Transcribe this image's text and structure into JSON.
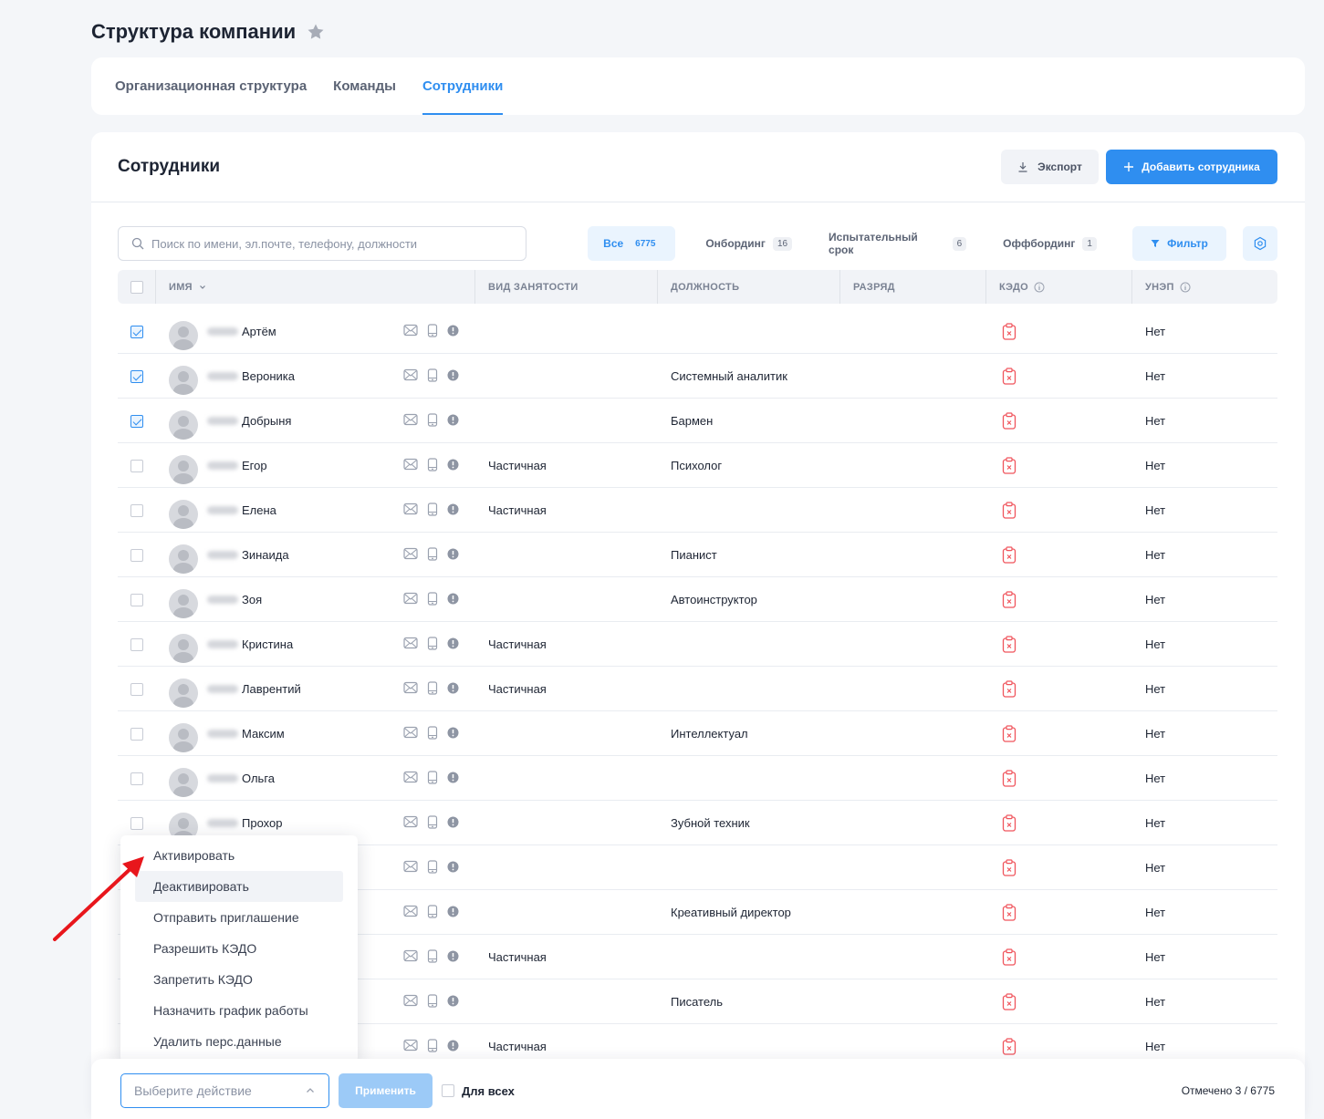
{
  "page": {
    "title": "Структура компании"
  },
  "tabs": [
    {
      "label": "Организационная структура"
    },
    {
      "label": "Команды"
    },
    {
      "label": "Сотрудники"
    }
  ],
  "card": {
    "title": "Сотрудники",
    "export_label": "Экспорт",
    "add_label": "Добавить сотрудника"
  },
  "search": {
    "placeholder": "Поиск по имени, эл.почте, телефону, должности"
  },
  "segments": [
    {
      "label": "Все",
      "count": "6775"
    },
    {
      "label": "Онбординг",
      "count": "16"
    },
    {
      "label": "Испытательный срок",
      "count": "6"
    },
    {
      "label": "Оффбординг",
      "count": "1"
    }
  ],
  "filter_label": "Фильтр",
  "columns": {
    "name": "ИМЯ",
    "employment": "ВИД ЗАНЯТОСТИ",
    "position": "ДОЛЖНОСТЬ",
    "grade": "РАЗРЯД",
    "kedo": "КЭДО",
    "unep": "УНЭП"
  },
  "rows": [
    {
      "name": "Артём",
      "checked": true,
      "employment": "",
      "position": "",
      "unep": "Нет"
    },
    {
      "name": "Вероника",
      "checked": true,
      "employment": "",
      "position": "Системный аналитик",
      "unep": "Нет"
    },
    {
      "name": "Добрыня",
      "checked": true,
      "employment": "",
      "position": "Бармен",
      "unep": "Нет"
    },
    {
      "name": "Егор",
      "checked": false,
      "employment": "Частичная",
      "position": "Психолог",
      "unep": "Нет"
    },
    {
      "name": "Елена",
      "checked": false,
      "employment": "Частичная",
      "position": "",
      "unep": "Нет"
    },
    {
      "name": "Зинаида",
      "checked": false,
      "employment": "",
      "position": "Пианист",
      "unep": "Нет"
    },
    {
      "name": "Зоя",
      "checked": false,
      "employment": "",
      "position": "Автоинструктор",
      "unep": "Нет"
    },
    {
      "name": "Кристина",
      "checked": false,
      "employment": "Частичная",
      "position": "",
      "unep": "Нет"
    },
    {
      "name": "Лаврентий",
      "checked": false,
      "employment": "Частичная",
      "position": "",
      "unep": "Нет"
    },
    {
      "name": "Максим",
      "checked": false,
      "employment": "",
      "position": "Интеллектуал",
      "unep": "Нет"
    },
    {
      "name": "Ольга",
      "checked": false,
      "employment": "",
      "position": "",
      "unep": "Нет"
    },
    {
      "name": "Прохор",
      "checked": false,
      "employment": "",
      "position": "Зубной техник",
      "unep": "Нет"
    },
    {
      "name": "",
      "checked": false,
      "employment": "",
      "position": "",
      "unep": "Нет"
    },
    {
      "name": "",
      "checked": false,
      "employment": "",
      "position": "Креативный директор",
      "unep": "Нет"
    },
    {
      "name": "",
      "checked": false,
      "employment": "Частичная",
      "position": "",
      "unep": "Нет"
    },
    {
      "name": "",
      "checked": false,
      "employment": "",
      "position": "Писатель",
      "unep": "Нет"
    },
    {
      "name": "",
      "checked": false,
      "employment": "Частичная",
      "position": "",
      "unep": "Нет"
    }
  ],
  "dropdown": {
    "items": [
      "Активировать",
      "Деактивировать",
      "Отправить приглашение",
      "Разрешить КЭДО",
      "Запретить КЭДО",
      "Назначить график работы",
      "Удалить перс.данные"
    ]
  },
  "bottom": {
    "select_placeholder": "Выберите действие",
    "apply_label": "Применить",
    "for_all_label": "Для всех",
    "selected_text": "Отмечено 3 / 6775"
  },
  "colors": {
    "accent": "#2f8ef0",
    "kedo_icon": "#f0545c",
    "annotation_arrow": "#e8161c"
  }
}
